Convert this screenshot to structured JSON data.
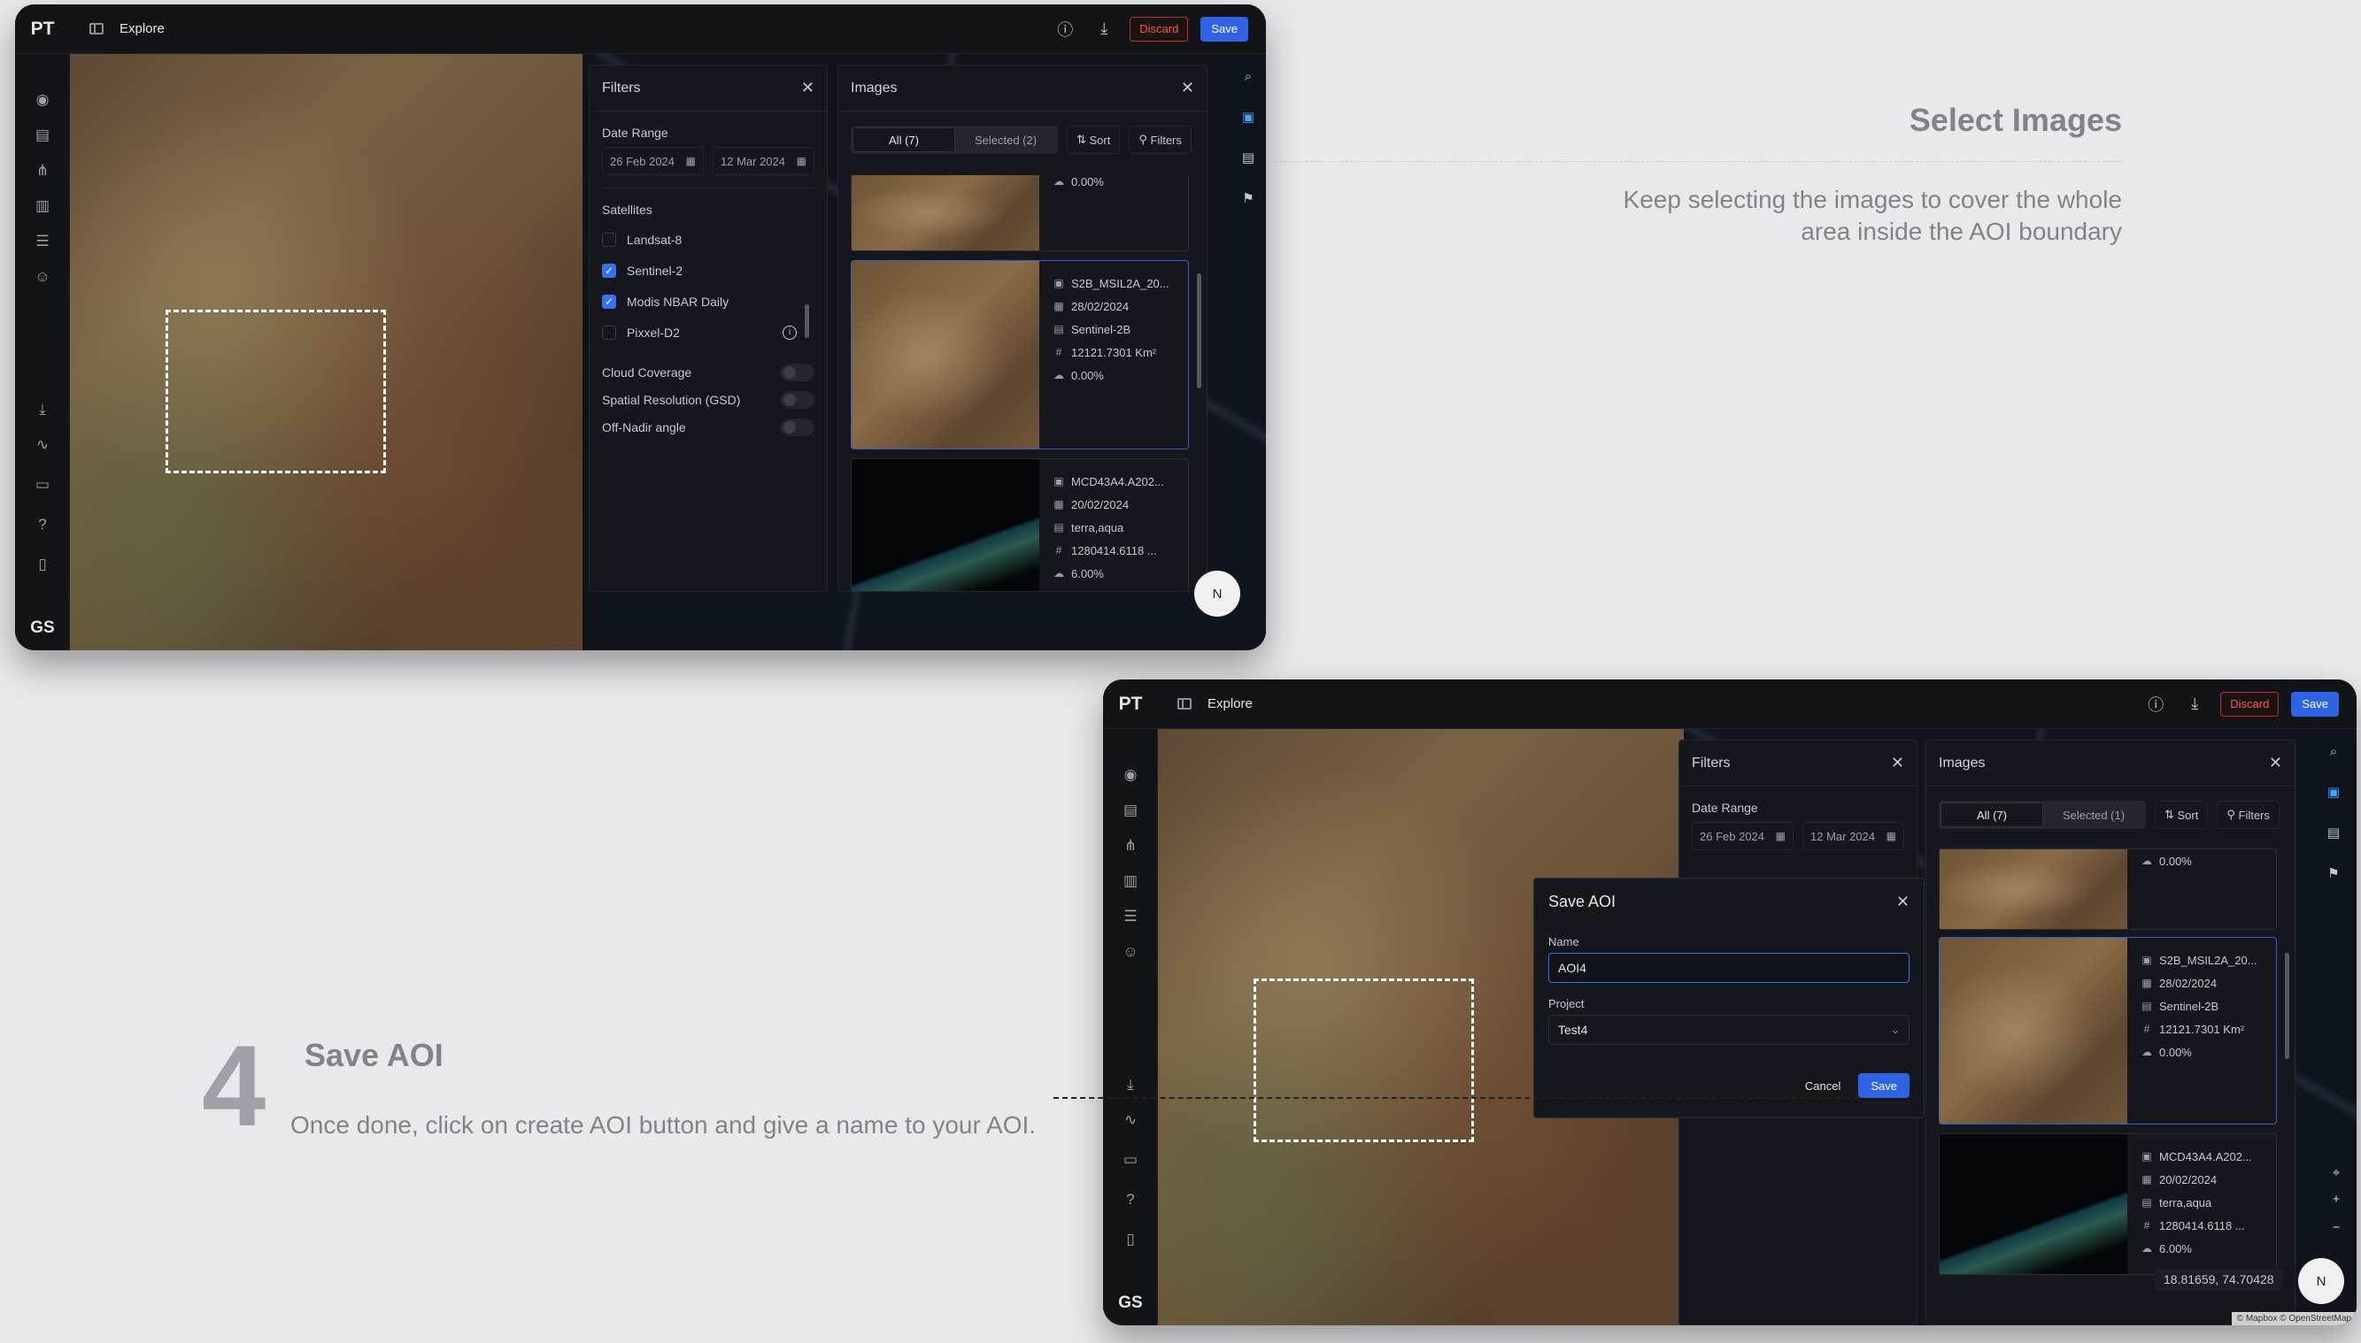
{
  "app": {
    "logo": "PT",
    "title": "Explore",
    "discard_label": "Discard",
    "save_label": "Save",
    "user_initials": "GS"
  },
  "filters": {
    "title": "Filters",
    "date_range_label": "Date Range",
    "start_date": "26 Feb 2024",
    "end_date": "12 Mar 2024",
    "satellites_label": "Satellites",
    "satellites": [
      {
        "name": "Landsat-8",
        "checked": false
      },
      {
        "name": "Sentinel-2",
        "checked": true
      },
      {
        "name": "Modis NBAR Daily",
        "checked": true
      },
      {
        "name": "Pixxel-D2",
        "checked": false
      }
    ],
    "toggles": [
      "Cloud Coverage",
      "Spatial Resolution (GSD)",
      "Off-Nadir angle"
    ]
  },
  "images": {
    "title": "Images",
    "tab_all": "All (7)",
    "tab_selected_1": "Selected (2)",
    "tab_selected_2": "Selected (1)",
    "sort_label": "Sort",
    "filters_label": "Filters",
    "cards": [
      {
        "cloud": "0.00%"
      },
      {
        "name": "S2B_MSIL2A_20...",
        "date": "28/02/2024",
        "satellite": "Sentinel-2B",
        "area": "12121.7301 Km²",
        "cloud": "0.00%"
      },
      {
        "name": "MCD43A4.A202...",
        "date": "20/02/2024",
        "satellite": "terra,aqua",
        "area": "1280414.6118 ...",
        "cloud": "6.00%"
      }
    ]
  },
  "modal": {
    "title": "Save AOI",
    "name_label": "Name",
    "name_value": "AOI4",
    "project_label": "Project",
    "project_value": "Test4",
    "cancel_label": "Cancel",
    "save_label": "Save"
  },
  "map": {
    "coords": "18.81659, 74.70428",
    "compass": "N",
    "attribution": "© Mapbox © OpenStreetMap"
  },
  "steps": {
    "select_title": "Select Images",
    "select_desc": "Keep selecting the images to cover the whole area inside the AOI boundary",
    "save_number": "4",
    "save_title": "Save AOI",
    "save_desc": "Once done, click on create AOI button and give a name to your AOI."
  }
}
